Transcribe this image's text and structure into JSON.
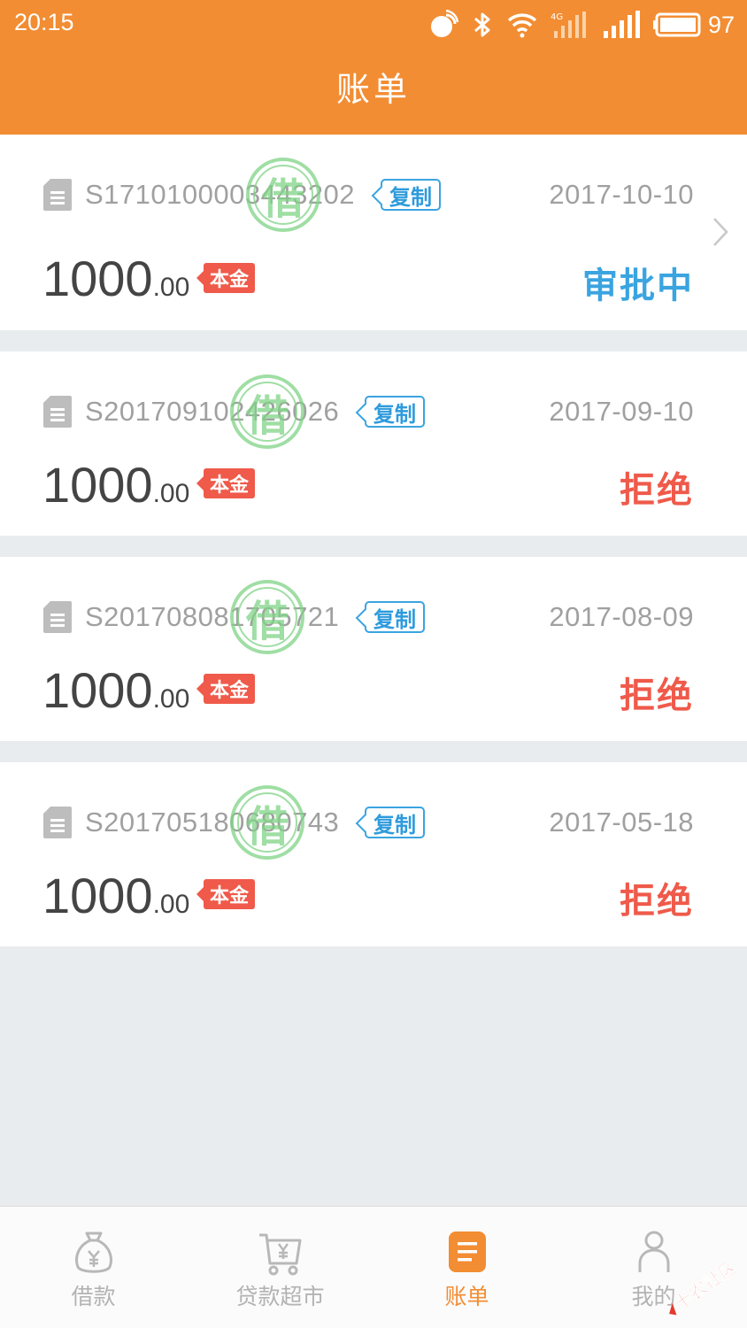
{
  "status_bar": {
    "time": "20:15",
    "battery": "97",
    "icons": [
      "nfc-icon",
      "bluetooth-icon",
      "wifi-icon",
      "4g-signal-icon",
      "signal-icon",
      "battery-icon"
    ]
  },
  "header": {
    "title": "账单"
  },
  "bills": [
    {
      "order_no": "S1710100003443202",
      "copy_label": "复制",
      "stamp_text": "借",
      "date": "2017-10-10",
      "amount_int": "1000",
      "amount_dec": ".00",
      "principal_label": "本金",
      "status": "审批中",
      "status_color": "#3aa4e0"
    },
    {
      "order_no": "S201709102426026",
      "copy_label": "复制",
      "stamp_text": "借",
      "date": "2017-09-10",
      "amount_int": "1000",
      "amount_dec": ".00",
      "principal_label": "本金",
      "status": "拒绝",
      "status_color": "#ef5a4a"
    },
    {
      "order_no": "S201708081705721",
      "copy_label": "复制",
      "stamp_text": "借",
      "date": "2017-08-09",
      "amount_int": "1000",
      "amount_dec": ".00",
      "principal_label": "本金",
      "status": "拒绝",
      "status_color": "#ef5a4a"
    },
    {
      "order_no": "S201705180680743",
      "copy_label": "复制",
      "stamp_text": "借",
      "date": "2017-05-18",
      "amount_int": "1000",
      "amount_dec": ".00",
      "principal_label": "本金",
      "status": "拒绝",
      "status_color": "#ef5a4a"
    }
  ],
  "tabs": [
    {
      "label": "借款",
      "icon": "money-bag-icon",
      "active": false
    },
    {
      "label": "贷款超市",
      "icon": "cart-icon",
      "active": false
    },
    {
      "label": "账单",
      "icon": "bill-icon",
      "active": true
    },
    {
      "label": "我的",
      "icon": "user-icon",
      "active": false
    }
  ],
  "watermark": {
    "text": "卡农社区"
  },
  "colors": {
    "header": "#f28d33",
    "accent_blue": "#3aa4e0",
    "reject_red": "#ef5a4a",
    "stamp_green": "#7fd386",
    "background": "#e8ecef"
  }
}
